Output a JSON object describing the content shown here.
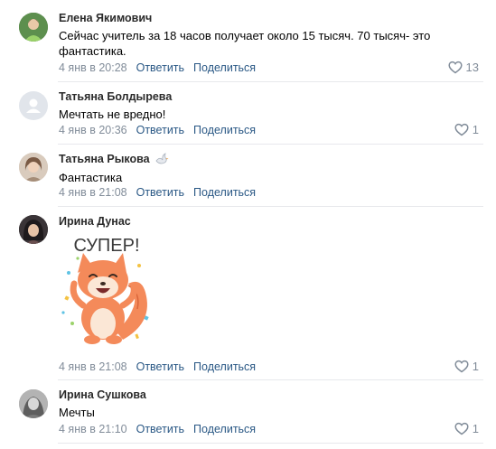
{
  "ui": {
    "reply": "Ответить",
    "share": "Поделиться"
  },
  "colors": {
    "link": "#2a5885",
    "meta": "#818c99",
    "divider": "#e7e8ec",
    "sticker_fox": "#f48a5a"
  },
  "icons": {
    "like": "heart-outline-icon",
    "badge": "dove-icon"
  },
  "comments": [
    {
      "author": "Елена Якимович",
      "text": "Сейчас учитель за 18 часов получает около 15 тысяч. 70 тысяч- это фантастика.",
      "date": "4 янв в 20:28",
      "likes": "13"
    },
    {
      "author": "Татьяна Болдырева",
      "text": "Мечтать не вредно!",
      "date": "4 янв в 20:36",
      "likes": "1"
    },
    {
      "author": "Татьяна Рыкова",
      "text": "Фантастика",
      "date": "4 янв в 21:08",
      "likes": ""
    },
    {
      "author": "Ирина Дунас",
      "sticker_text": "СУПЕР!",
      "date": "4 янв в 21:08",
      "likes": "1"
    },
    {
      "author": "Ирина Сушкова",
      "text": "Мечты",
      "date": "4 янв в 21:10",
      "likes": "1"
    }
  ]
}
